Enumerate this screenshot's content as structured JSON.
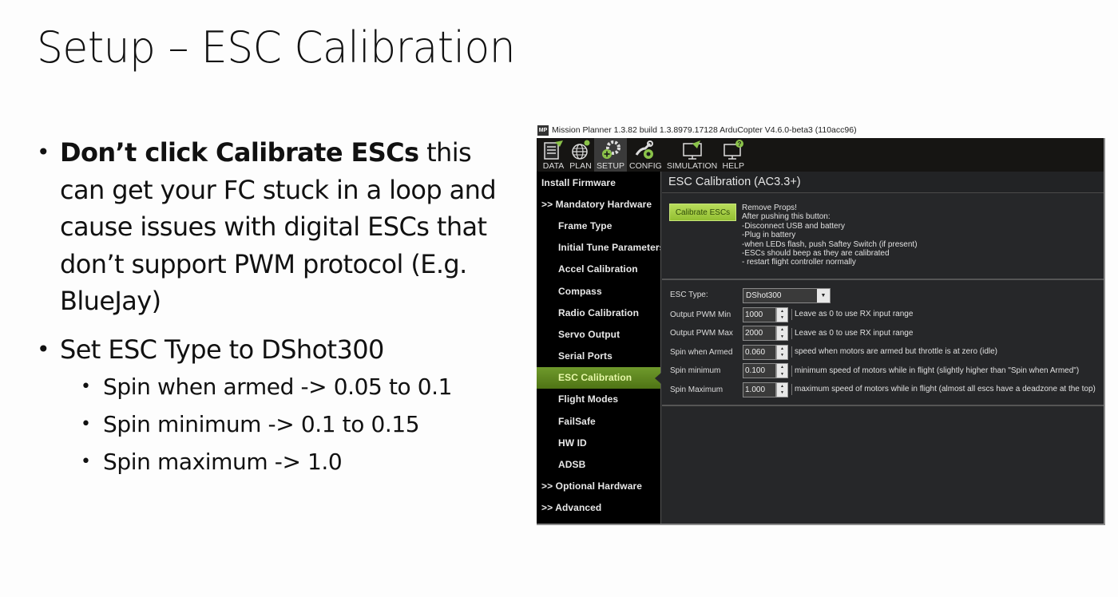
{
  "slide": {
    "title": "Setup – ESC Calibration",
    "bullet1": {
      "bold": "Don’t click Calibrate ESCs",
      "rest": " this can get your FC stuck in a loop and cause issues with digital ESCs that don’t support PWM protocol (E.g. BlueJay)"
    },
    "bullet2": "Set ESC Type to DShot300",
    "subbullets": [
      "Spin when armed -> 0.05 to 0.1",
      "Spin minimum -> 0.1 to 0.15",
      "Spin maximum -> 1.0"
    ],
    "bullet_glyph": "•"
  },
  "app": {
    "logo": "MP",
    "window_title": "Mission Planner 1.3.82 build 1.3.8979.17128 ArduCopter V4.6.0-beta3 (110acc96)",
    "toolbar": [
      {
        "label": "DATA",
        "icon": "data-icon"
      },
      {
        "label": "PLAN",
        "icon": "plan-globe-icon"
      },
      {
        "label": "SETUP",
        "icon": "setup-gear-icon"
      },
      {
        "label": "CONFIG",
        "icon": "config-wrench-icon"
      },
      {
        "label": "SIMULATION",
        "icon": "simulation-monitor-icon"
      },
      {
        "label": "HELP",
        "icon": "help-monitor-icon"
      }
    ],
    "active_tab": "SETUP",
    "sidebar": [
      {
        "label": "Install Firmware",
        "level": "top"
      },
      {
        "label": ">> Mandatory Hardware",
        "level": "top"
      },
      {
        "label": "Frame Type",
        "level": "sub"
      },
      {
        "label": "Initial Tune Parameters",
        "level": "sub"
      },
      {
        "label": "Accel Calibration",
        "level": "sub"
      },
      {
        "label": "Compass",
        "level": "sub"
      },
      {
        "label": "Radio Calibration",
        "level": "sub"
      },
      {
        "label": "Servo Output",
        "level": "sub"
      },
      {
        "label": "Serial Ports",
        "level": "sub"
      },
      {
        "label": "ESC Calibration",
        "level": "sub",
        "selected": true
      },
      {
        "label": "Flight Modes",
        "level": "sub"
      },
      {
        "label": "FailSafe",
        "level": "sub"
      },
      {
        "label": "HW ID",
        "level": "sub"
      },
      {
        "label": "ADSB",
        "level": "sub"
      },
      {
        "label": ">> Optional Hardware",
        "level": "top"
      },
      {
        "label": ">> Advanced",
        "level": "top"
      }
    ],
    "content": {
      "header": "ESC Calibration (AC3.3+)",
      "calibrate_button": "Calibrate ESCs",
      "instructions": [
        "Remove Props!",
        "After pushing this button:",
        "-Disconnect USB and battery",
        "-Plug in battery",
        "-when LEDs flash, push Saftey Switch (if present)",
        "-ESCs should beep as they are calibrated",
        "- restart flight controller normally"
      ],
      "esc_type": {
        "label": "ESC Type:",
        "value": "DShot300"
      },
      "fields": [
        {
          "label": "Output PWM Min",
          "value": "1000",
          "help": "Leave as 0 to use RX input range"
        },
        {
          "label": "Output PWM Max",
          "value": "2000",
          "help": "Leave as 0 to use RX input range"
        },
        {
          "label": "Spin when Armed",
          "value": "0.060",
          "help": "speed when motors are armed but throttle is at zero (idle)"
        },
        {
          "label": "Spin minimum",
          "value": "0.100",
          "help": "minimum speed of motors while in flight (slightly higher than \"Spin when Armed\")"
        },
        {
          "label": "Spin Maximum",
          "value": "1.000",
          "help": "maximum speed of motors while in flight (almost all escs have a deadzone at the top)"
        }
      ]
    },
    "colors": {
      "accent_green": "#93bf32",
      "selected_item": "#5f8a20",
      "background": "#262729",
      "sidebar": "#000000"
    }
  }
}
